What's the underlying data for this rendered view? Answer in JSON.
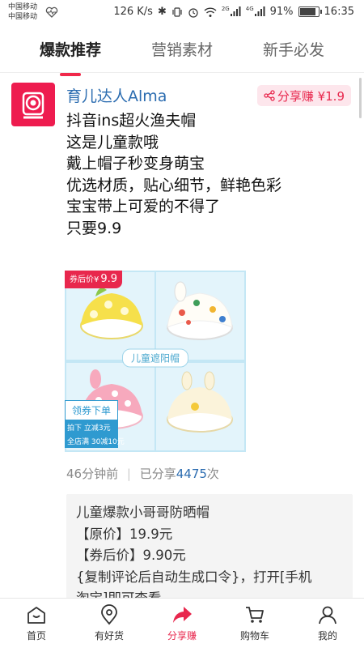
{
  "status_bar": {
    "carrier_1": "中国移动",
    "carrier_2": "中国移动",
    "speed": "126 K/s",
    "signal_tag_1": "2G",
    "signal_tag_2": "4G",
    "battery": "91%",
    "battery_level": 0.91,
    "time": "16:35"
  },
  "tabs": [
    {
      "label": "爆款推荐",
      "active": true
    },
    {
      "label": "营销素材",
      "active": false
    },
    {
      "label": "新手必发",
      "active": false
    }
  ],
  "post": {
    "author": "育儿达人Alma",
    "share_badge": "分享赚 ¥1.9",
    "lines": [
      "抖音ins超火渔夫帽",
      "这是儿童款哦",
      "戴上帽子秒变身萌宝",
      "优选材质，贴心细节，鲜艳色彩",
      "宝宝带上可爱的不得了",
      "只要9.9"
    ],
    "product_image": {
      "price_tag_prefix": "券后价¥",
      "price_tag_value": "9.9",
      "center_label": "儿童遮阳帽",
      "coupon_title": "领券下单",
      "coupon_line_1": "拍下 立减3元",
      "coupon_line_2": "全店满 30减10元"
    },
    "time_ago": "46分钟前",
    "shared_prefix": "已分享",
    "shared_count": "4475",
    "shared_suffix": "次",
    "comment_lines": [
      "儿童爆款小哥哥防晒帽",
      "【原价】19.9元",
      "【券后价】9.90元",
      "{复制评论后自动生成口令}，打开[手机",
      "淘宝]即可查看"
    ]
  },
  "bottom_nav": [
    {
      "label": "首页",
      "icon": "home-icon",
      "active": false
    },
    {
      "label": "有好货",
      "icon": "location-pin-icon",
      "active": false
    },
    {
      "label": "分享赚",
      "icon": "share-arrow-icon",
      "active": true
    },
    {
      "label": "购物车",
      "icon": "cart-icon",
      "active": false
    },
    {
      "label": "我的",
      "icon": "profile-icon",
      "active": false
    }
  ],
  "colors": {
    "accent": "#e8274d",
    "link_blue": "#2b6cb0",
    "avatar_bg": "#ee1c4f"
  }
}
